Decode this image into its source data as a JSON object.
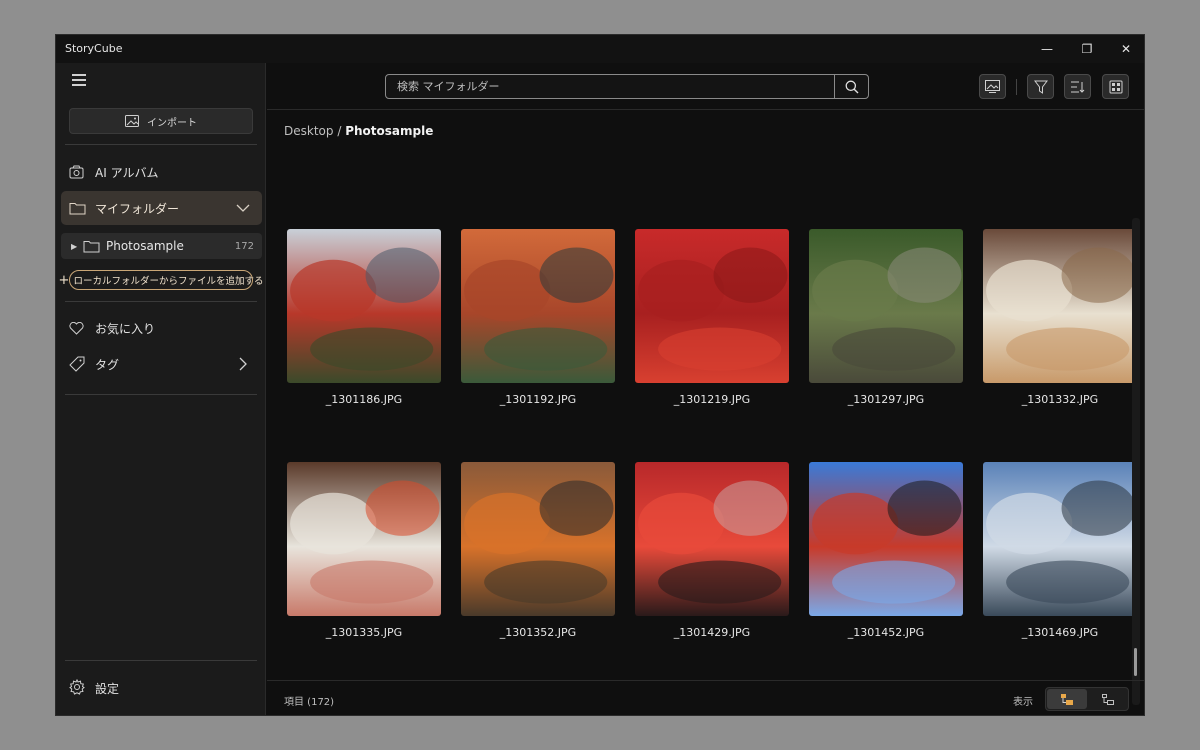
{
  "app": {
    "title": "StoryCube"
  },
  "window_controls": {
    "minimize": "—",
    "restore": "❐",
    "close": "✕"
  },
  "sidebar": {
    "import_label": "インポート",
    "nav": [
      {
        "label": "AI アルバム",
        "icon": "ai-album-icon"
      },
      {
        "label": "マイフォルダー",
        "icon": "folder-icon"
      },
      {
        "label": "お気に入り",
        "icon": "heart-icon"
      },
      {
        "label": "タグ",
        "icon": "tag-icon"
      }
    ],
    "folder": {
      "name": "Photosample",
      "count": "172"
    },
    "add_folder_label": "ローカルフォルダーからファイルを追加する",
    "settings_label": "設定"
  },
  "search": {
    "placeholder": "検索 マイフォルダー"
  },
  "breadcrumb": {
    "parent": "Desktop",
    "separator": "/",
    "current": "Photosample"
  },
  "photos": [
    {
      "name": "_1301186.JPG",
      "colors": [
        "#c8d0d8",
        "#b8382a",
        "#3b4a2a",
        "#4a5a6a"
      ]
    },
    {
      "name": "_1301192.JPG",
      "colors": [
        "#d26a3a",
        "#a8462a",
        "#3b5a3a",
        "#2b3a3a"
      ]
    },
    {
      "name": "_1301219.JPG",
      "colors": [
        "#c82a2a",
        "#a82020",
        "#d84030",
        "#8a1818"
      ]
    },
    {
      "name": "_1301297.JPG",
      "colors": [
        "#3a5a2a",
        "#6a7a4a",
        "#4a4a3a",
        "#8a8a7a"
      ]
    },
    {
      "name": "_1301332.JPG",
      "colors": [
        "#6a4a3a",
        "#e8e0d0",
        "#c89a6a",
        "#8a6a4a"
      ]
    },
    {
      "name": "_1301335.JPG",
      "colors": [
        "#5a3a2a",
        "#e8e4dc",
        "#c87a6a",
        "#d84a2a"
      ]
    },
    {
      "name": "_1301352.JPG",
      "colors": [
        "#8a5a3a",
        "#d8722a",
        "#4a3a2a",
        "#2a2a2a"
      ]
    },
    {
      "name": "_1301429.JPG",
      "colors": [
        "#b8282a",
        "#e84a3a",
        "#2a1a1a",
        "#c8a0a0"
      ]
    },
    {
      "name": "_1301452.JPG",
      "colors": [
        "#3a7ad8",
        "#c83a2a",
        "#7aa8e8",
        "#1a1a1a"
      ]
    },
    {
      "name": "_1301469.JPG",
      "colors": [
        "#5a82b8",
        "#d0dae6",
        "#3a4a5a",
        "#2a3440"
      ]
    }
  ],
  "status": {
    "items_label": "項目 (172)",
    "view_label": "表示"
  }
}
